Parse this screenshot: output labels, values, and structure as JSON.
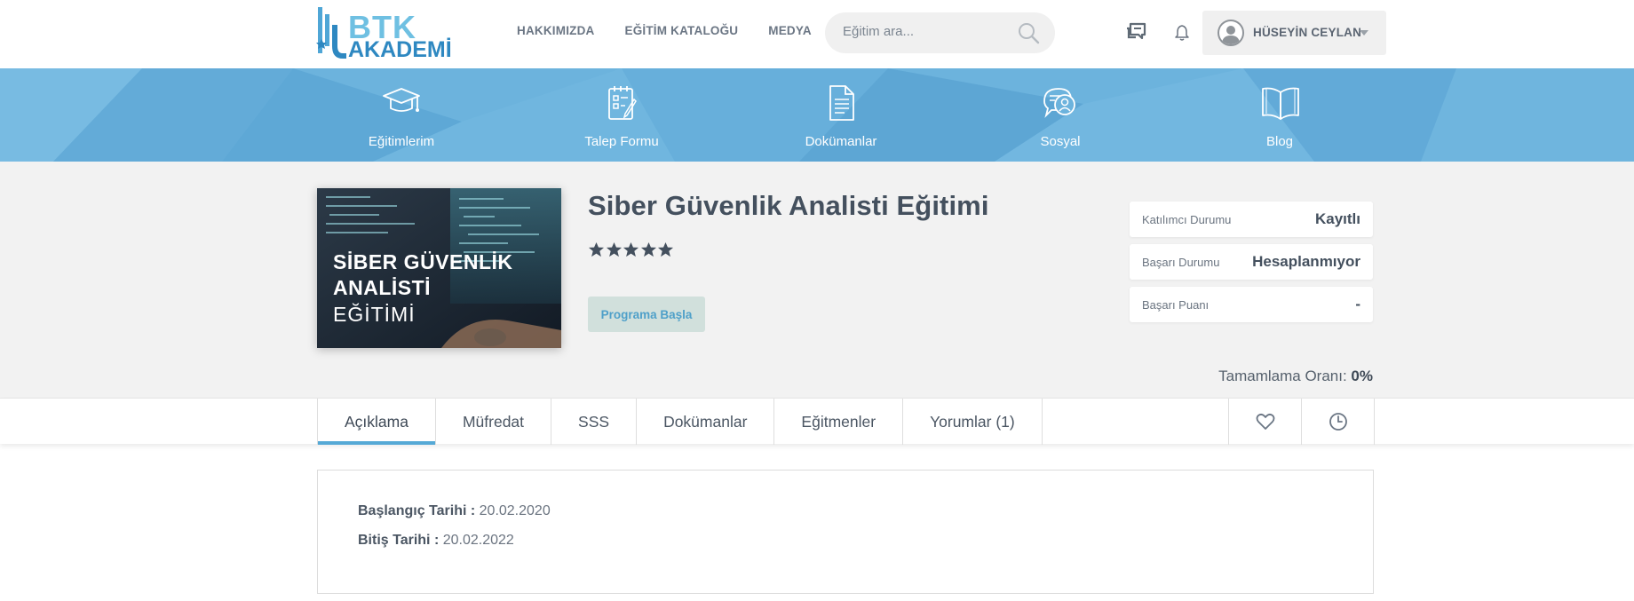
{
  "header": {
    "logo_line1": "BTK",
    "logo_line2": "AKADEMİ",
    "nav": [
      {
        "label": "HAKKIMIZDA"
      },
      {
        "label": "EĞİTİM KATALOĞU"
      },
      {
        "label": "MEDYA"
      }
    ],
    "search_placeholder": "Eğitim ara...",
    "user_name": "HÜSEYİN CEYLAN"
  },
  "quicklinks": [
    {
      "label": "Eğitimlerim",
      "icon": "graduation-cap-icon"
    },
    {
      "label": "Talep Formu",
      "icon": "form-icon"
    },
    {
      "label": "Dokümanlar",
      "icon": "document-icon"
    },
    {
      "label": "Sosyal",
      "icon": "social-chat-icon"
    },
    {
      "label": "Blog",
      "icon": "open-book-icon"
    }
  ],
  "course": {
    "thumbnail_line1": "SİBER GÜVENLİK",
    "thumbnail_line2": "ANALİSTİ",
    "thumbnail_line3": "EĞİTİMİ",
    "title": "Siber Güvenlik Analisti Eğitimi",
    "rating": 5,
    "rating_max": 5,
    "start_button": "Programa Başla",
    "status": [
      {
        "label": "Katılımcı Durumu",
        "value": "Kayıtlı"
      },
      {
        "label": "Başarı Durumu",
        "value": "Hesaplanmıyor"
      },
      {
        "label": "Başarı Puanı",
        "value": "-"
      }
    ],
    "completion_label": "Tamamlama Oranı:",
    "completion_value": "0%"
  },
  "tabs": [
    {
      "label": "Açıklama",
      "active": true
    },
    {
      "label": "Müfredat"
    },
    {
      "label": "SSS"
    },
    {
      "label": "Dokümanlar"
    },
    {
      "label": "Eğitmenler"
    },
    {
      "label": "Yorumlar (1)"
    }
  ],
  "description": {
    "start_label": "Başlangıç Tarihi :",
    "start_value": "20.02.2020",
    "end_label": "Bitiş Tarihi :",
    "end_value": "20.02.2022"
  },
  "colors": {
    "accent": "#55a9d6",
    "banner": "#6cb3dd",
    "title": "#44505e"
  }
}
